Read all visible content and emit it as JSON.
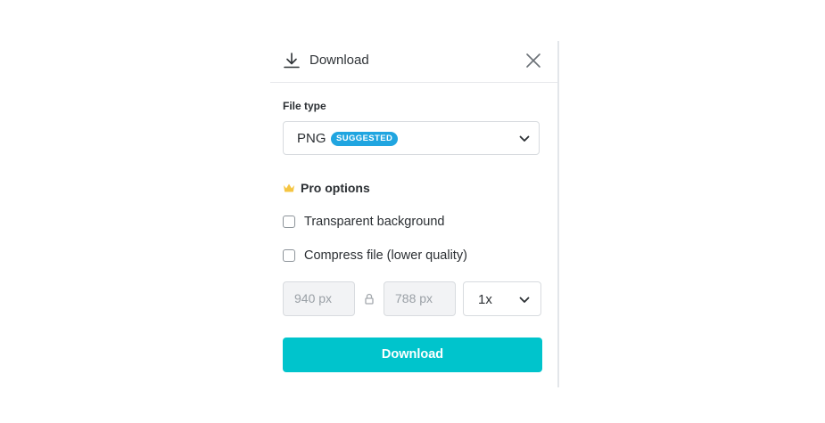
{
  "header": {
    "title": "Download",
    "icon": "download-icon",
    "close_icon": "close-icon"
  },
  "file_type": {
    "label": "File type",
    "selected": "PNG",
    "badge": "SUGGESTED",
    "badge_color": "#20a5e0"
  },
  "pro_options": {
    "label": "Pro options",
    "icon": "crown-icon",
    "icon_color": "#f5c542",
    "options": [
      {
        "label": "Transparent background",
        "checked": false
      },
      {
        "label": "Compress file (lower quality)",
        "checked": false
      }
    ]
  },
  "size": {
    "width_placeholder": "940 px",
    "height_placeholder": "788 px",
    "lock_icon": "lock-icon",
    "scale": "1x"
  },
  "action": {
    "download_label": "Download",
    "color": "#00c4cc"
  }
}
